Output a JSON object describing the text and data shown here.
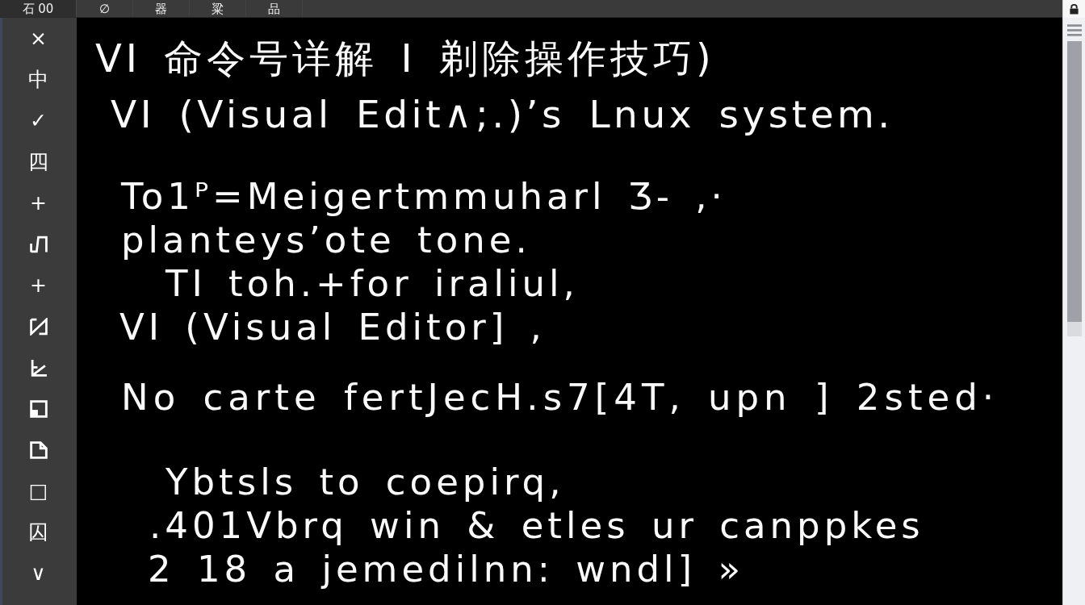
{
  "toolbar": {
    "label": "石 00",
    "tools": [
      "∅",
      "器",
      "粱",
      "品"
    ]
  },
  "sidebar": {
    "tools": [
      {
        "kind": "glyph",
        "text": "×"
      },
      {
        "kind": "glyph",
        "text": "中"
      },
      {
        "kind": "glyph",
        "text": "✓"
      },
      {
        "kind": "glyph",
        "text": "四"
      },
      {
        "kind": "glyph",
        "text": "+"
      },
      {
        "kind": "hook"
      },
      {
        "kind": "glyph",
        "text": "+"
      },
      {
        "kind": "slashed"
      },
      {
        "kind": "angle"
      },
      {
        "kind": "notched"
      },
      {
        "kind": "folded"
      },
      {
        "kind": "glyph",
        "text": "□"
      },
      {
        "kind": "glyph",
        "text": "囚"
      },
      {
        "kind": "glyph",
        "text": "∨"
      }
    ]
  },
  "document": {
    "title": "VI 命令号详解 I 剃除操作技巧)",
    "paragraphs": [
      {
        "lines": [
          "VI (Visual Edit∧;.)’s Lnux system."
        ]
      },
      {
        "lines": [
          "To1ᴾ=Meigertmmuharl Ʒ- ,·",
          "planteys’ote tone.",
          "TI toh.+for iraliul,",
          "VI (Visual Editor] ,"
        ]
      },
      {
        "lines": [
          "No carte fertJecH.s7[4T, upn ] 2sted·"
        ]
      },
      {
        "lines": [
          "Ybtsls to coepirq,",
          ".401Vbrq win & etles ur canppkes",
          "2 18 a jemedilnn: wndl] »"
        ]
      }
    ]
  }
}
